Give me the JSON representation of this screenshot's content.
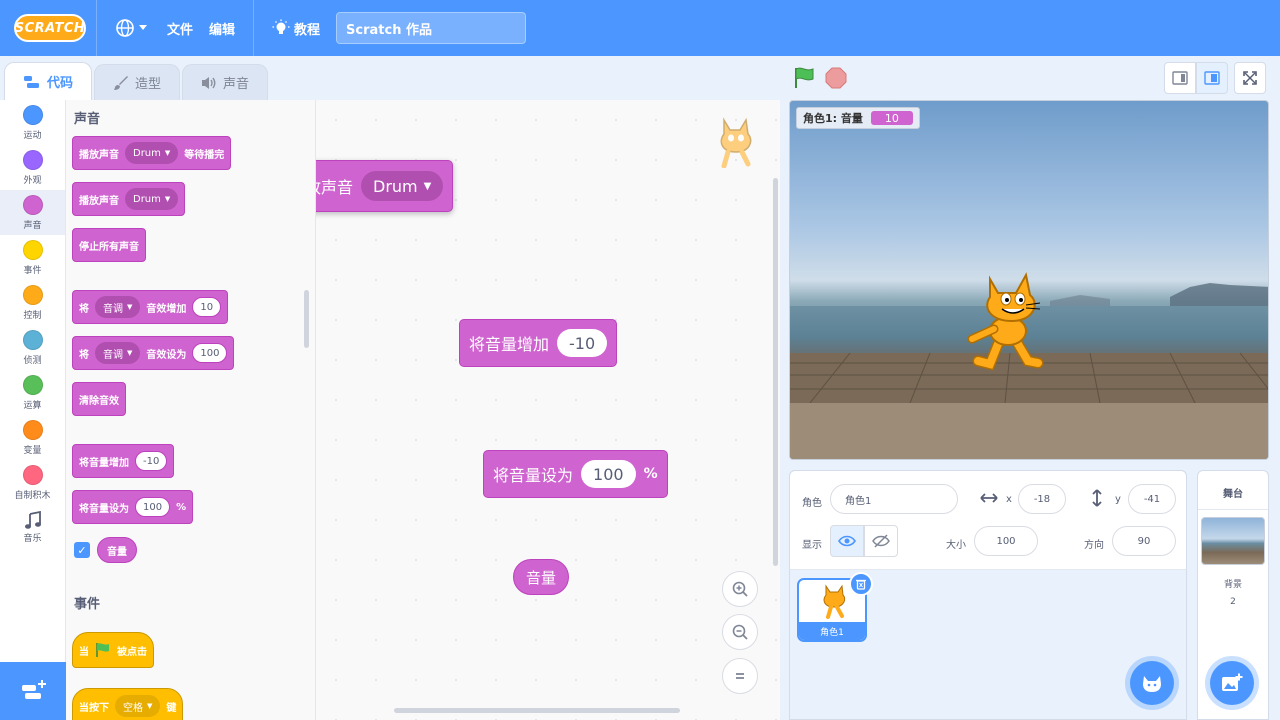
{
  "menu": {
    "logo": "SCRATCH",
    "file": "文件",
    "edit": "编辑",
    "tutorials": "教程",
    "project_title": "Scratch 作品"
  },
  "tabs": [
    {
      "label": "代码",
      "active": true
    },
    {
      "label": "造型",
      "active": false
    },
    {
      "label": "声音",
      "active": false
    }
  ],
  "categories": [
    {
      "label": "运动",
      "color": "#4c97ff"
    },
    {
      "label": "外观",
      "color": "#9966ff"
    },
    {
      "label": "声音",
      "color": "#cf63cf",
      "active": true
    },
    {
      "label": "事件",
      "color": "#ffd500"
    },
    {
      "label": "控制",
      "color": "#ffab19"
    },
    {
      "label": "侦测",
      "color": "#5cb1d6"
    },
    {
      "label": "运算",
      "color": "#59c059"
    },
    {
      "label": "变量",
      "color": "#ff8c1a"
    },
    {
      "label": "自制积木",
      "color": "#ff6680"
    },
    {
      "label": "音乐",
      "icon": "music-note-icon"
    }
  ],
  "palette": {
    "sound_title": "声音",
    "play_until_done": {
      "pre": "播放声音",
      "sound": "Drum",
      "post": "等待播完"
    },
    "start_sound": {
      "pre": "播放声音",
      "sound": "Drum"
    },
    "stop_all": "停止所有声音",
    "change_effect": {
      "pre": "将",
      "effect": "音调",
      "mid": "音效增加",
      "value": "10"
    },
    "set_effect": {
      "pre": "将",
      "effect": "音调",
      "mid": "音效设为",
      "value": "100"
    },
    "clear_effects": "清除音效",
    "change_volume": {
      "label": "将音量增加",
      "value": "-10"
    },
    "set_volume": {
      "label": "将音量设为",
      "value": "100",
      "unit": "%"
    },
    "volume_reporter": "音量",
    "events_title": "事件",
    "when_flag": {
      "pre": "当",
      "post": "被点击"
    },
    "when_key": {
      "pre": "当按下",
      "key": "空格",
      "post": "键"
    }
  },
  "workspace": {
    "start_sound": {
      "pre": "播放声音",
      "sound": "Drum"
    },
    "change_volume": {
      "label": "将音量增加",
      "value": "-10"
    },
    "set_volume": {
      "label": "将音量设为",
      "value": "100",
      "unit": "%"
    },
    "volume_reporter": "音量"
  },
  "stage": {
    "monitor_label": "角色1: 音量",
    "monitor_value": "10"
  },
  "sprite_info": {
    "sprite_label": "角色",
    "sprite_name": "角色1",
    "x_label": "x",
    "x_value": "-18",
    "y_label": "y",
    "y_value": "-41",
    "show_label": "显示",
    "size_label": "大小",
    "size_value": "100",
    "direction_label": "方向",
    "direction_value": "90"
  },
  "sprite_list": [
    {
      "name": "角色1",
      "selected": true
    }
  ],
  "stage_selector": {
    "title": "舞台",
    "backdrops_label": "背景",
    "backdrops_count": "2"
  },
  "colors": {
    "menu_blue": "#4c97ff",
    "sound_purple": "#cf63cf",
    "events_yellow": "#ffbf00"
  }
}
